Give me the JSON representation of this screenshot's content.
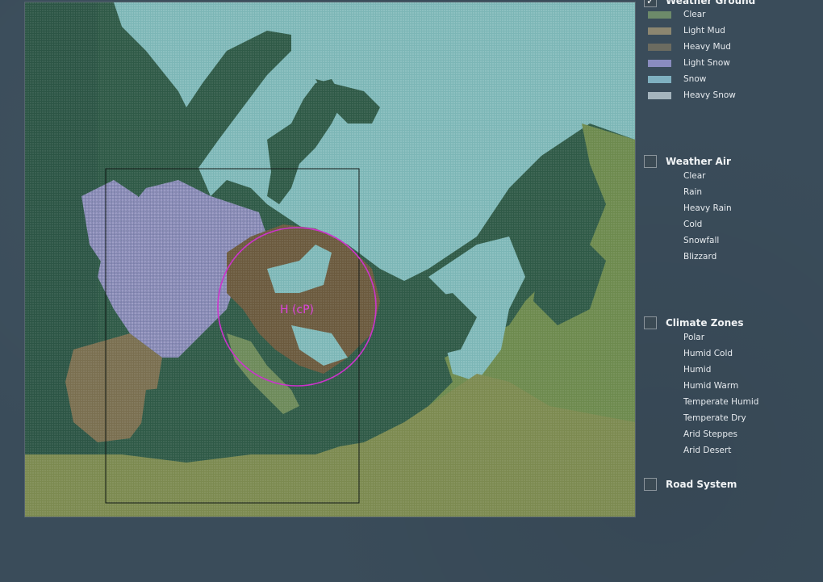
{
  "map": {
    "pressure_label": "H (cP)"
  },
  "sections": {
    "weather_ground": {
      "title": "Weather Ground",
      "checked": true,
      "items": [
        {
          "label": "Clear",
          "color": "#6d8a6a"
        },
        {
          "label": "Light Mud",
          "color": "#8c8670"
        },
        {
          "label": "Heavy Mud",
          "color": "#6b6b60"
        },
        {
          "label": "Light Snow",
          "color": "#8a8cbf"
        },
        {
          "label": "Snow",
          "color": "#7fb0c0"
        },
        {
          "label": "Heavy Snow",
          "color": "#a5b4bd"
        }
      ]
    },
    "weather_air": {
      "title": "Weather Air",
      "checked": false,
      "items": [
        "Clear",
        "Rain",
        "Heavy Rain",
        "Cold",
        "Snowfall",
        "Blizzard"
      ]
    },
    "climate_zones": {
      "title": "Climate Zones",
      "checked": false,
      "items": [
        "Polar",
        "Humid Cold",
        "Humid",
        "Humid Warm",
        "Temperate Humid",
        "Temperate Dry",
        "Arid Steppes",
        "Arid Desert"
      ]
    },
    "road_system": {
      "title": "Road System",
      "checked": false
    }
  },
  "colors": {
    "sea": "#2f5a47",
    "land_clear": "#6d8a5a",
    "mud": "#6b5a40",
    "snow": "#7fb8b8",
    "light_snow": "#8a8cbf",
    "pressure_circle": "#cc33cc"
  }
}
